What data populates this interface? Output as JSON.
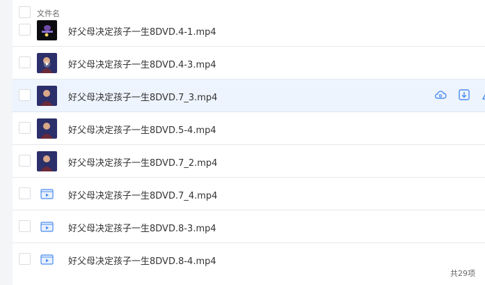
{
  "header": {
    "column_label": "文件名"
  },
  "files": [
    {
      "name": "好父母决定孩子一生8DVD.4-1.mp4",
      "thumb": "dark-video-thumbnail"
    },
    {
      "name": "好父母决定孩子一生8DVD.4-3.mp4",
      "thumb": "person-video-thumbnail"
    },
    {
      "name": "好父母决定孩子一生8DVD.7_3.mp4",
      "thumb": "person-video-thumbnail"
    },
    {
      "name": "好父母决定孩子一生8DVD.5-4.mp4",
      "thumb": "person-video-thumbnail"
    },
    {
      "name": "好父母决定孩子一生8DVD.7_2.mp4",
      "thumb": "person-video-thumbnail"
    },
    {
      "name": "好父母决定孩子一生8DVD.7_4.mp4",
      "thumb": "video-file-icon"
    },
    {
      "name": "好父母决定孩子一生8DVD.8-3.mp4",
      "thumb": "video-file-icon"
    },
    {
      "name": "好父母决定孩子一生8DVD.8-4.mp4",
      "thumb": "video-file-icon"
    }
  ],
  "hover_actions": [
    "cloud-icon",
    "download-icon",
    "share-icon"
  ],
  "footer": {
    "count_text": "共29项"
  },
  "colors": {
    "accent": "#4a8cf0",
    "hover_row": "#eef4fd",
    "thumb_bg": "#2b2f6a"
  }
}
